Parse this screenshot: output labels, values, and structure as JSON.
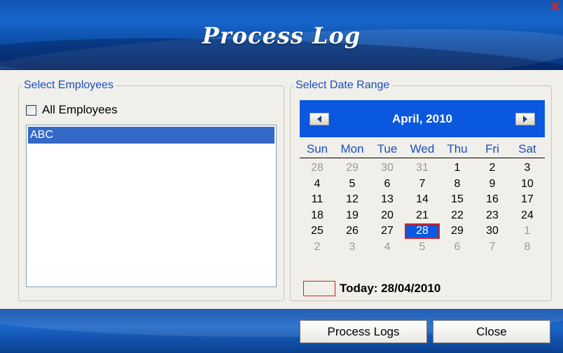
{
  "window": {
    "title": "Process Log",
    "close_glyph": "✕"
  },
  "employees": {
    "legend": "Select Employees",
    "all_label": "All Employees",
    "all_checked": false,
    "items": [
      "ABC"
    ]
  },
  "date_range": {
    "legend": "Select Date Range",
    "month_label": "April, 2010",
    "weekdays": [
      "Sun",
      "Mon",
      "Tue",
      "Wed",
      "Thu",
      "Fri",
      "Sat"
    ],
    "weeks": [
      [
        {
          "d": "28",
          "o": true
        },
        {
          "d": "29",
          "o": true
        },
        {
          "d": "30",
          "o": true
        },
        {
          "d": "31",
          "o": true
        },
        {
          "d": "1"
        },
        {
          "d": "2"
        },
        {
          "d": "3"
        }
      ],
      [
        {
          "d": "4"
        },
        {
          "d": "5"
        },
        {
          "d": "6"
        },
        {
          "d": "7"
        },
        {
          "d": "8"
        },
        {
          "d": "9"
        },
        {
          "d": "10"
        }
      ],
      [
        {
          "d": "11"
        },
        {
          "d": "12"
        },
        {
          "d": "13"
        },
        {
          "d": "14"
        },
        {
          "d": "15"
        },
        {
          "d": "16"
        },
        {
          "d": "17"
        }
      ],
      [
        {
          "d": "18"
        },
        {
          "d": "19"
        },
        {
          "d": "20"
        },
        {
          "d": "21"
        },
        {
          "d": "22"
        },
        {
          "d": "23"
        },
        {
          "d": "24"
        }
      ],
      [
        {
          "d": "25"
        },
        {
          "d": "26"
        },
        {
          "d": "27"
        },
        {
          "d": "28",
          "s": true
        },
        {
          "d": "29"
        },
        {
          "d": "30"
        },
        {
          "d": "1",
          "o": true
        }
      ],
      [
        {
          "d": "2",
          "o": true
        },
        {
          "d": "3",
          "o": true
        },
        {
          "d": "4",
          "o": true
        },
        {
          "d": "5",
          "o": true
        },
        {
          "d": "6",
          "o": true
        },
        {
          "d": "7",
          "o": true
        },
        {
          "d": "8",
          "o": true
        }
      ]
    ],
    "today_label": "Today: 28/04/2010",
    "prev_icon": "chevron-left-icon",
    "next_icon": "chevron-right-icon"
  },
  "buttons": {
    "process": "Process Logs",
    "close": "Close"
  },
  "colors": {
    "accent": "#0a57e0",
    "selection": "#3469c7",
    "today_outline": "#d42020",
    "legend": "#1a4fc0"
  }
}
